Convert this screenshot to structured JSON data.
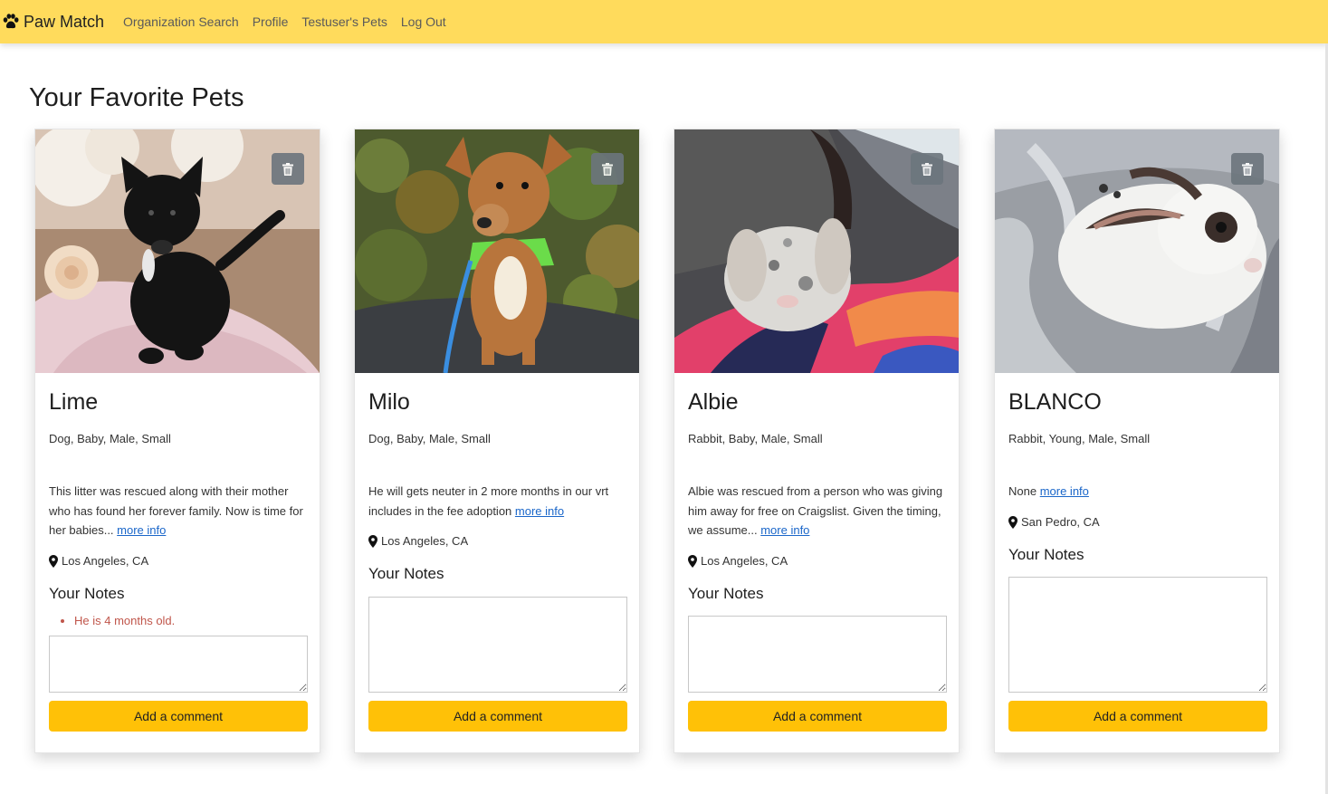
{
  "nav": {
    "brand": "Paw Match",
    "links": [
      "Organization Search",
      "Profile",
      "Testuser's Pets",
      "Log Out"
    ]
  },
  "page": {
    "title": "Your Favorite Pets"
  },
  "labels": {
    "notes_title": "Your Notes",
    "add_comment": "Add a comment",
    "more_info": "more info"
  },
  "pets": [
    {
      "name": "Lime",
      "meta": "Dog, Baby, Male, Small",
      "description": "This litter was rescued along with their mother who has found her forever family. Now is time for her babies...",
      "location": "Los Angeles, CA",
      "notes": [
        "He is 4 months old."
      ],
      "photo": "black puppy on pink blanket with rose"
    },
    {
      "name": "Milo",
      "meta": "Dog, Baby, Male, Small",
      "description": "He will gets neuter in 2 more months in our vrt includes in the fee adoption",
      "location": "Los Angeles, CA",
      "notes": [],
      "photo": "tan puppy with green harness by hedge"
    },
    {
      "name": "Albie",
      "meta": "Rabbit, Baby, Male, Small",
      "description": "Albie was rescued from a person who was giving him away for free on Craigslist. Given the timing, we assume...",
      "location": "Los Angeles, CA",
      "notes": [],
      "photo": "grey spotted lop rabbit on colorful lap"
    },
    {
      "name": "BLANCO",
      "meta": "Rabbit, Young, Male, Small",
      "description": "None",
      "location": "San Pedro, CA",
      "notes": [],
      "photo": "white rabbit with dark ears in grey blanket"
    }
  ]
}
